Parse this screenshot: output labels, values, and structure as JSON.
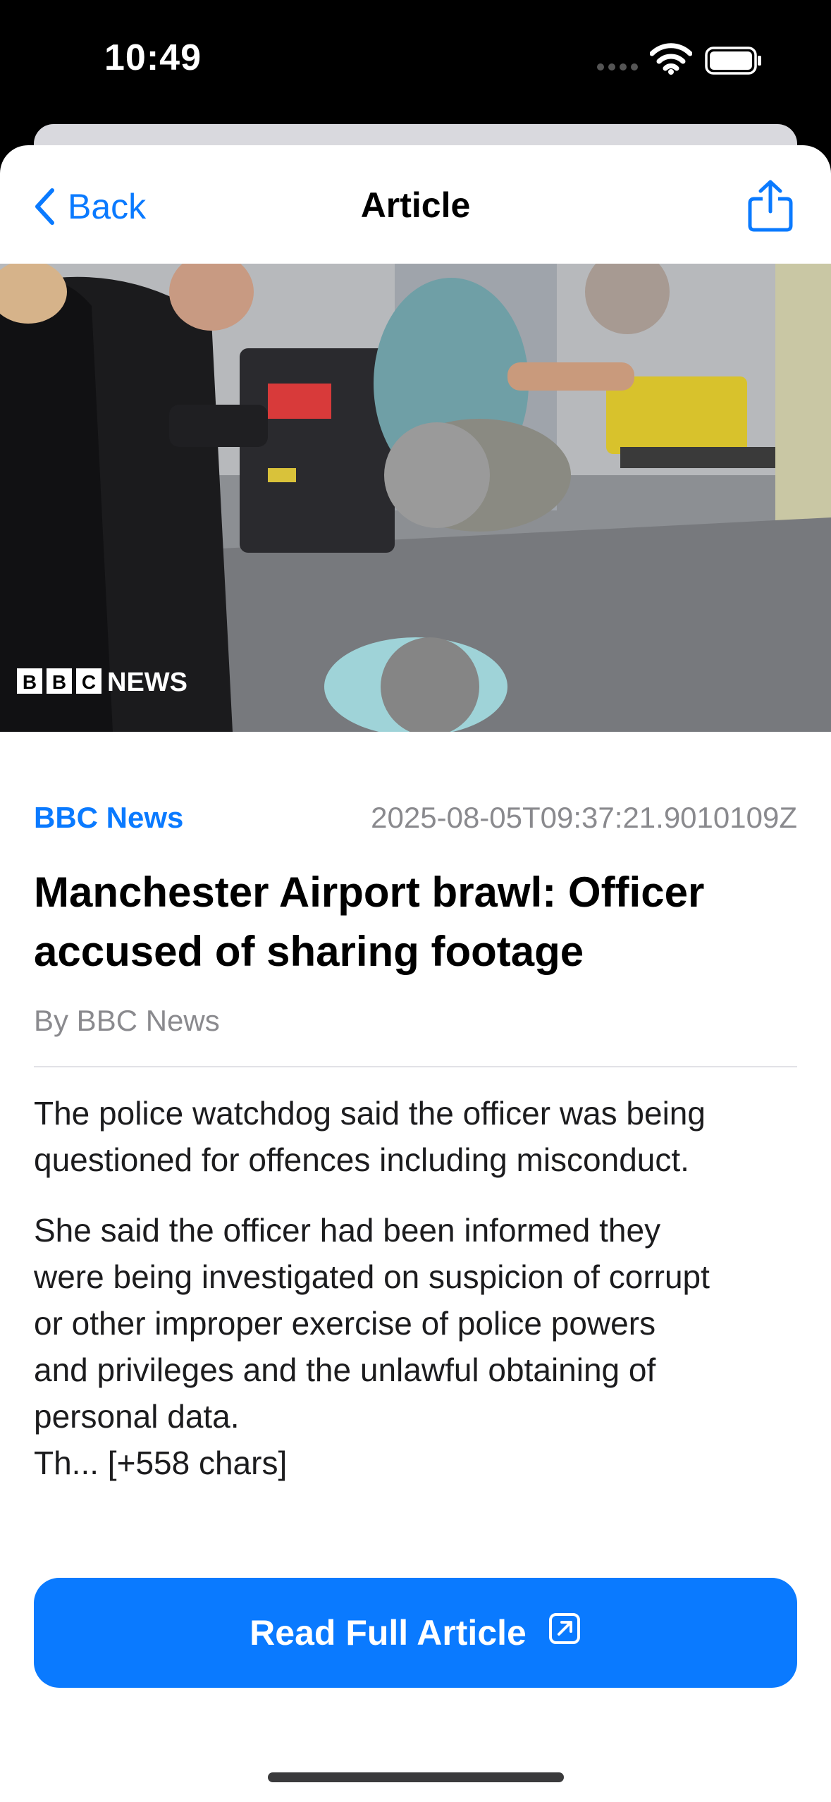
{
  "status_bar": {
    "time": "10:49"
  },
  "navbar": {
    "back_label": "Back",
    "title": "Article"
  },
  "hero_image": {
    "watermark": "BBC NEWS"
  },
  "article": {
    "source": "BBC News",
    "published": "2025-08-05T09:37:21.9010109Z",
    "headline_line1": "Manchester Airport brawl: Officer",
    "headline_line2": "accused of sharing footage",
    "byline": "By BBC News",
    "paragraph1_line1": "The police watchdog said the officer was being",
    "paragraph1_line2": "questioned for offences including misconduct.",
    "paragraph2_line1": "She said the officer had been informed they",
    "paragraph2_line2": "were being investigated on suspicion of corrupt",
    "paragraph2_line3": "or other improper exercise of police powers",
    "paragraph2_line4": "and privileges and the unlawful obtaining of",
    "paragraph2_line5": "personal data.",
    "paragraph2_line6": "Th... [+558 chars]"
  },
  "actions": {
    "read_full_label": "Read Full Article"
  },
  "colors": {
    "accent": "#0a7aff",
    "secondary_text": "#8a8a8e"
  },
  "icons": [
    "chevron-left-icon",
    "share-icon",
    "external-link-icon",
    "wifi-icon",
    "battery-icon",
    "cellular-signal-icon"
  ]
}
